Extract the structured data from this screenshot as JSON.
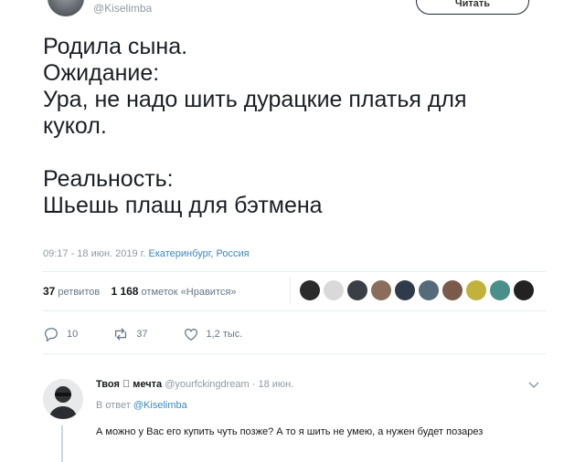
{
  "author": {
    "handle": "@Kiselimba"
  },
  "follow_button": {
    "label": "Читать"
  },
  "tweet": {
    "lines": [
      "Родила сына.",
      "Ожидание:",
      "Ура, не надо шить дурацкие платья для",
      "кукол.",
      "",
      "Реальность:",
      "Шьешь плащ для бэтмена"
    ],
    "timestamp": "09:17 - 18 июн. 2019 г.",
    "location": "Екатеринбург, Россия"
  },
  "stats": {
    "retweets_count": "37",
    "retweets_label": "ретвитов",
    "likes_count": "1 168",
    "likes_label": "отметок «Нравится»"
  },
  "likers": [
    "#2b2b2b",
    "#d9d9d9",
    "#3a3f45",
    "#8a6d5a",
    "#2f3a4a",
    "#556b7a",
    "#7a5a4a",
    "#c0b23a",
    "#4a8f8a",
    "#222222"
  ],
  "actions": {
    "replies": "10",
    "retweets": "37",
    "likes": "1,2 тыс."
  },
  "reply": {
    "name": "Твоя ⃞ мечта",
    "handle": "@yourfckingdream",
    "date": "· 18 июн.",
    "in_reply_label": "В ответ",
    "in_reply_handle": "@Kiselimba",
    "text": "А можно у Вас его купить чуть позже? А то я шить не умею, а нужен будет позарез"
  }
}
